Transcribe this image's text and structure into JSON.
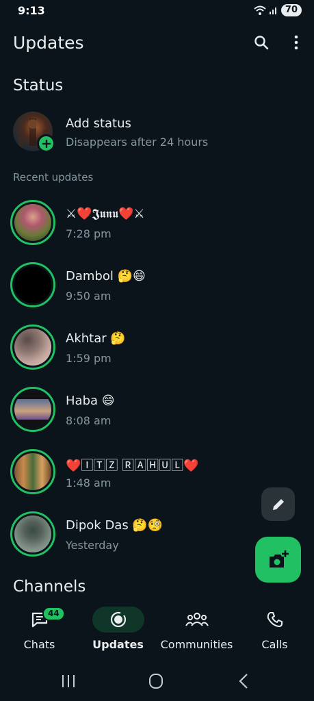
{
  "statusbar": {
    "time": "9:13",
    "battery": "70"
  },
  "header": {
    "title": "Updates"
  },
  "status_section": {
    "title": "Status",
    "add_status": {
      "label": "Add status",
      "subtitle": "Disappears after 24 hours"
    },
    "recent_label": "Recent updates",
    "items": [
      {
        "name": "⚔❤️𝕵𝖚𝖓𝖚❤️⚔",
        "time": "7:28 pm"
      },
      {
        "name": "Dambol 🤔😄",
        "time": "9:50 am"
      },
      {
        "name": "Akhtar 🤔",
        "time": "1:59 pm"
      },
      {
        "name": "Haba 😄",
        "time": "8:08 am"
      },
      {
        "name": "❤️🄸🅃🅉 🅁🄰🄷🅄🄻❤️",
        "time": "1:48 am"
      },
      {
        "name": "Dipok Das 🤔🧐",
        "time": "Yesterday"
      }
    ]
  },
  "channels": {
    "title": "Channels"
  },
  "nav": {
    "chats": {
      "label": "Chats",
      "badge": "44"
    },
    "updates": {
      "label": "Updates"
    },
    "communities": {
      "label": "Communities"
    },
    "calls": {
      "label": "Calls"
    }
  },
  "colors": {
    "background": "#0b141a",
    "accent": "#21c063",
    "muted": "#8696a0"
  }
}
